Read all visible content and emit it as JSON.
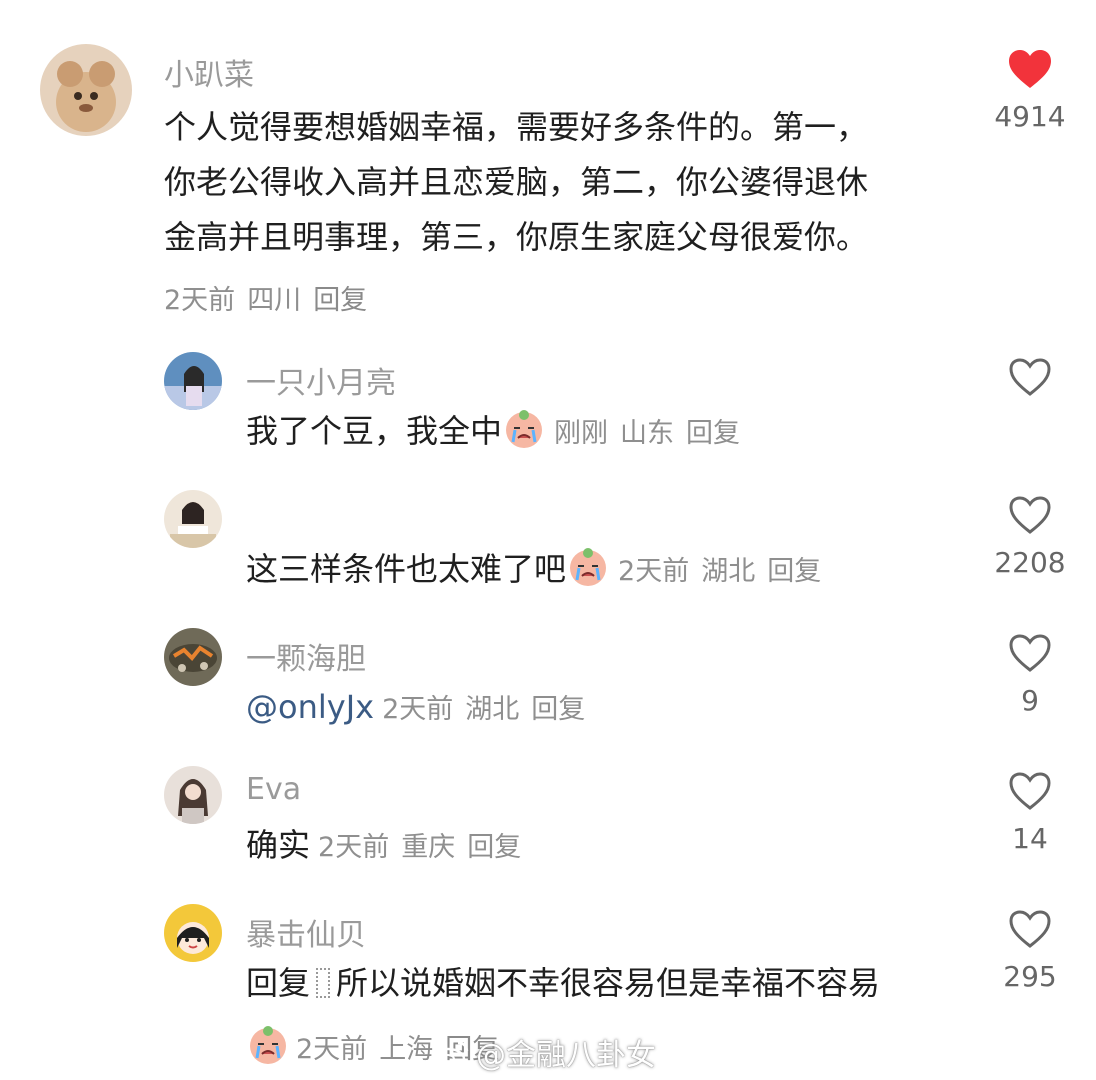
{
  "comments": [
    {
      "name": "小趴菜",
      "lines": [
        "个人觉得要想婚姻幸福，需要好多条件的。第一，",
        "你老公得收入高并且恋爱脑，第二，你公婆得退休",
        "金高并且明事理，第三，你原生家庭父母很爱你。"
      ],
      "time": "2天前",
      "location": "四川",
      "reply": "回复",
      "likes": "4914",
      "liked": true
    },
    {
      "name": "一只小月亮",
      "text": "我了个豆，我全中",
      "time": "刚刚",
      "location": "山东",
      "reply": "回复"
    },
    {
      "name": "",
      "text": "这三样条件也太难了吧",
      "time": "2天前",
      "location": "湖北",
      "reply": "回复",
      "likes": "2208"
    },
    {
      "name": "一颗海胆",
      "mention": "@onlyJx",
      "time": "2天前",
      "location": "湖北",
      "reply": "回复",
      "likes": "9"
    },
    {
      "name": "Eva",
      "text": "确实",
      "time": "2天前",
      "location": "重庆",
      "reply": "回复",
      "likes": "14"
    },
    {
      "name": "暴击仙贝",
      "prefix": "回复",
      "text": "所以说婚姻不幸很容易但是幸福不容易",
      "time": "2天前",
      "location": "上海",
      "reply": "回复",
      "likes": "295"
    }
  ],
  "watermark": "@金融八卦女",
  "colors": {
    "liked_heart": "#f2333b",
    "mention": "#3b5b84",
    "meta": "#8f8f8f"
  },
  "icons": {
    "like": "heart-outline-icon",
    "liked": "heart-filled-icon",
    "emoji": "crying-emoji-icon",
    "watermark": "weibo-logo-icon"
  }
}
